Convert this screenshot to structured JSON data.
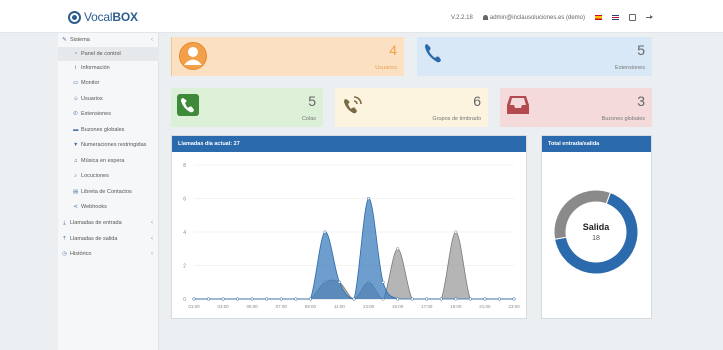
{
  "header": {
    "logo_vocal": "Vocal",
    "logo_box": "BOX",
    "version": "V.2.2.18",
    "user": "admin@inclausoluciones.es (demo)"
  },
  "sidebar": {
    "sistema": "Sistema",
    "items": [
      {
        "label": "Panel de control",
        "icon": "dashboard-icon"
      },
      {
        "label": "Información",
        "icon": "info-icon"
      },
      {
        "label": "Monitor",
        "icon": "monitor-icon"
      },
      {
        "label": "Usuarios",
        "icon": "user-icon"
      },
      {
        "label": "Extensiones",
        "icon": "phone-icon"
      },
      {
        "label": "Buzones globales",
        "icon": "inbox-icon"
      },
      {
        "label": "Numeraciones restringidas",
        "icon": "filter-icon"
      },
      {
        "label": "Música en espera",
        "icon": "music-icon"
      },
      {
        "label": "Locuciones",
        "icon": "microphone-icon"
      },
      {
        "label": "Libreta de Contactos",
        "icon": "book-icon"
      },
      {
        "label": "Webhooks",
        "icon": "share-icon"
      }
    ],
    "sections": [
      {
        "label": "Llamadas de entrada"
      },
      {
        "label": "Llamadas de salida"
      },
      {
        "label": "Histórico"
      }
    ]
  },
  "stats": {
    "usuarios": {
      "value": "4",
      "label": "Usuarios"
    },
    "extensiones": {
      "value": "5",
      "label": "Extensiones"
    },
    "colas": {
      "value": "5",
      "label": "Colas"
    },
    "grupos": {
      "value": "6",
      "label": "Grupos de timbrado"
    },
    "buzones": {
      "value": "3",
      "label": "Buzones globales"
    }
  },
  "calls_panel": {
    "title": "Llamadas día actual: 27"
  },
  "total_panel": {
    "title": "Total entrada/salida",
    "center_label": "Salida",
    "center_value": "18"
  },
  "colors": {
    "accent": "#2b6aac",
    "series_blue": "#3d7ebd",
    "series_gray": "#9a9a9a"
  },
  "chart_data": {
    "type": "area",
    "x": [
      "01:00",
      "02:00",
      "03:00",
      "04:00",
      "05:00",
      "06:00",
      "07:00",
      "08:00",
      "09:00",
      "10:00",
      "11:00",
      "12:00",
      "13:00",
      "14:00",
      "15:00",
      "16:00",
      "17:00",
      "18:00",
      "19:00",
      "20:00",
      "21:00",
      "22:00",
      "23:00"
    ],
    "x_tick_labels": [
      "01:00",
      "03:00",
      "05:00",
      "07:00",
      "09:00",
      "11:00",
      "13:00",
      "15:00",
      "17:00",
      "19:00",
      "21:00",
      "23:00"
    ],
    "ylim": [
      0,
      8
    ],
    "y_ticks": [
      "0",
      "2",
      "4",
      "6",
      "8"
    ],
    "series": [
      {
        "values": [
          0,
          0,
          0,
          0,
          0,
          0,
          0,
          0,
          0,
          4,
          1,
          0,
          6,
          1,
          0,
          0,
          0,
          0,
          0,
          0,
          0,
          0,
          0
        ]
      },
      {
        "values": [
          0,
          0,
          0,
          0,
          0,
          0,
          0,
          0,
          0,
          1,
          1,
          0,
          1,
          0,
          3,
          0,
          0,
          0,
          4,
          0,
          0,
          0,
          0
        ]
      }
    ]
  },
  "donut_data": {
    "type": "pie",
    "slices": [
      {
        "label": "Salida",
        "value": 18
      },
      {
        "label": "Entrada",
        "value": 9
      }
    ]
  }
}
